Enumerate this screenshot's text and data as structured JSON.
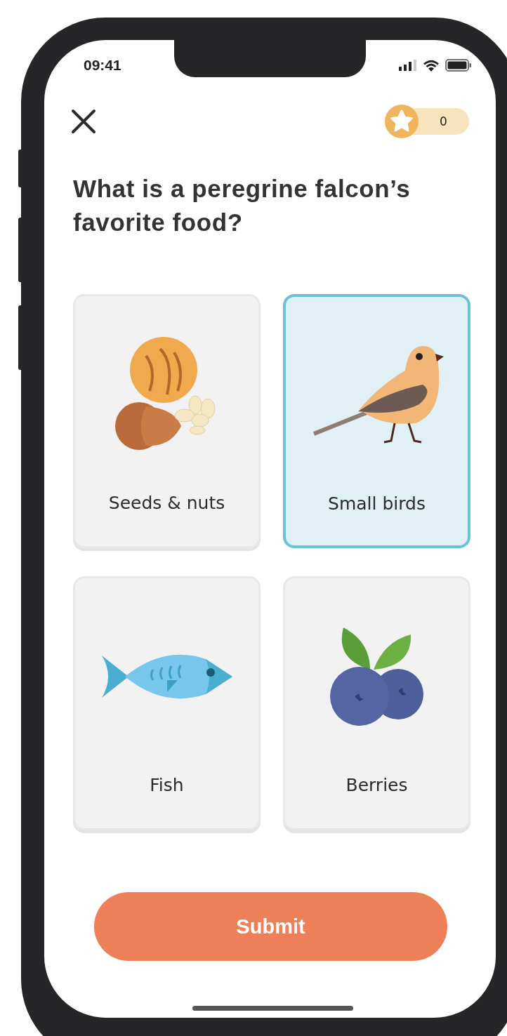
{
  "status_bar": {
    "time": "09:41"
  },
  "header": {
    "score": "0"
  },
  "question": "What is a peregrine falcon’s favorite food?",
  "options": [
    {
      "label": "Seeds & nuts",
      "kind": "seeds",
      "selected": false
    },
    {
      "label": "Small birds",
      "kind": "bird",
      "selected": true
    },
    {
      "label": "Fish",
      "kind": "fish",
      "selected": false
    },
    {
      "label": "Berries",
      "kind": "berries",
      "selected": false
    }
  ],
  "submit": {
    "label": "Submit"
  }
}
